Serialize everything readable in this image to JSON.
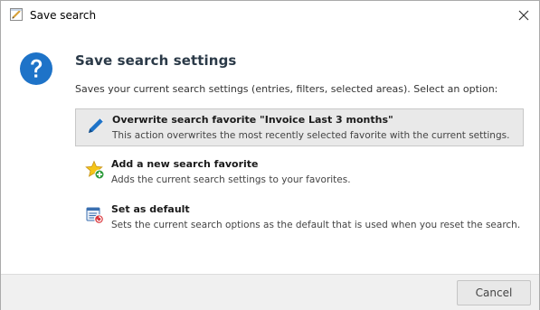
{
  "window": {
    "title": "Save search",
    "app_icon": "edit-document-icon",
    "close_icon": "close-icon"
  },
  "dialog": {
    "icon": "question-icon",
    "heading": "Save search settings",
    "subtext": "Saves your current search settings (entries, filters, selected areas). Select an option:"
  },
  "options": [
    {
      "icon": "pencil-icon",
      "title": "Overwrite search favorite \"Invoice Last 3 months\"",
      "description": "This action overwrites the most recently selected favorite with the current settings.",
      "selected": true
    },
    {
      "icon": "star-add-icon",
      "title": "Add a new search favorite",
      "description": "Adds the current search settings to your favorites.",
      "selected": false
    },
    {
      "icon": "set-default-icon",
      "title": "Set as default",
      "description": "Sets the current search options as the default that is used when you reset the search.",
      "selected": false
    }
  ],
  "footer": {
    "cancel_label": "Cancel"
  },
  "colors": {
    "accent_blue": "#1e73c8",
    "heading": "#2b3a48",
    "selected_bg": "#e9e9e9"
  }
}
